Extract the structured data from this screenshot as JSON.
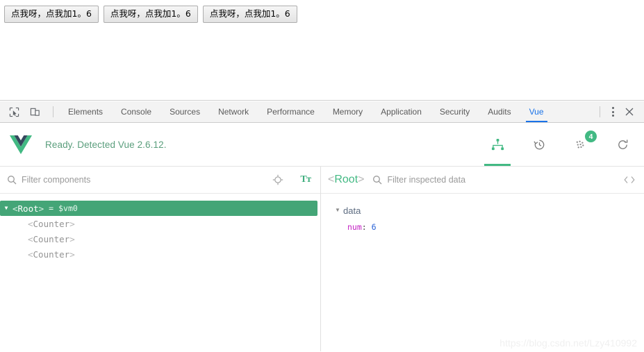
{
  "page": {
    "buttons": [
      {
        "label": "点我呀，点我加1。6"
      },
      {
        "label": "点我呀，点我加1。6"
      },
      {
        "label": "点我呀，点我加1。6"
      }
    ]
  },
  "devtools": {
    "left_icons": [
      {
        "name": "inspect-element-icon"
      },
      {
        "name": "device-toolbar-icon"
      }
    ],
    "tabs": [
      {
        "label": "Elements",
        "active": false
      },
      {
        "label": "Console",
        "active": false
      },
      {
        "label": "Sources",
        "active": false
      },
      {
        "label": "Network",
        "active": false
      },
      {
        "label": "Performance",
        "active": false
      },
      {
        "label": "Memory",
        "active": false
      },
      {
        "label": "Application",
        "active": false
      },
      {
        "label": "Security",
        "active": false
      },
      {
        "label": "Audits",
        "active": false
      },
      {
        "label": "Vue",
        "active": true
      }
    ],
    "more_label": "⋮",
    "close_label": "✕",
    "accent_color": "#1a73e8"
  },
  "vue": {
    "status": "Ready. Detected Vue 2.6.12.",
    "brand_color": "#42b983",
    "header_actions": [
      {
        "name": "components-tree-icon",
        "active": true,
        "badge": ""
      },
      {
        "name": "history-timeline-icon",
        "active": false,
        "badge": ""
      },
      {
        "name": "vuex-dots-icon",
        "active": false,
        "badge": "4"
      },
      {
        "name": "refresh-icon",
        "active": false,
        "badge": ""
      }
    ],
    "components_filter": {
      "placeholder": "Filter components",
      "value": ""
    },
    "components_filter_actions": [
      {
        "name": "select-component-target-icon"
      },
      {
        "name": "font-size-icon",
        "label": "Tт"
      }
    ],
    "tree": {
      "root": {
        "caret": "▼",
        "open_angle": "<",
        "name": "Root",
        "close_angle": ">",
        "assign": "=",
        "vm_ref": "$vm0",
        "selected": true
      },
      "children": [
        {
          "open_angle": "<",
          "name": "Counter",
          "close_angle": ">"
        },
        {
          "open_angle": "<",
          "name": "Counter",
          "close_angle": ">"
        },
        {
          "open_angle": "<",
          "name": "Counter",
          "close_angle": ">"
        }
      ]
    },
    "inspector": {
      "selected_component": {
        "open_angle": "<",
        "name": "Root",
        "close_angle": ">"
      },
      "filter": {
        "placeholder": "Filter inspected data",
        "value": ""
      },
      "code_icon_label": "<>",
      "groups": [
        {
          "caret": "▼",
          "title": "data",
          "items": [
            {
              "key": "num",
              "colon": ":",
              "value": "6"
            }
          ]
        }
      ]
    }
  },
  "watermark": "https://blog.csdn.net/Lzy410992"
}
